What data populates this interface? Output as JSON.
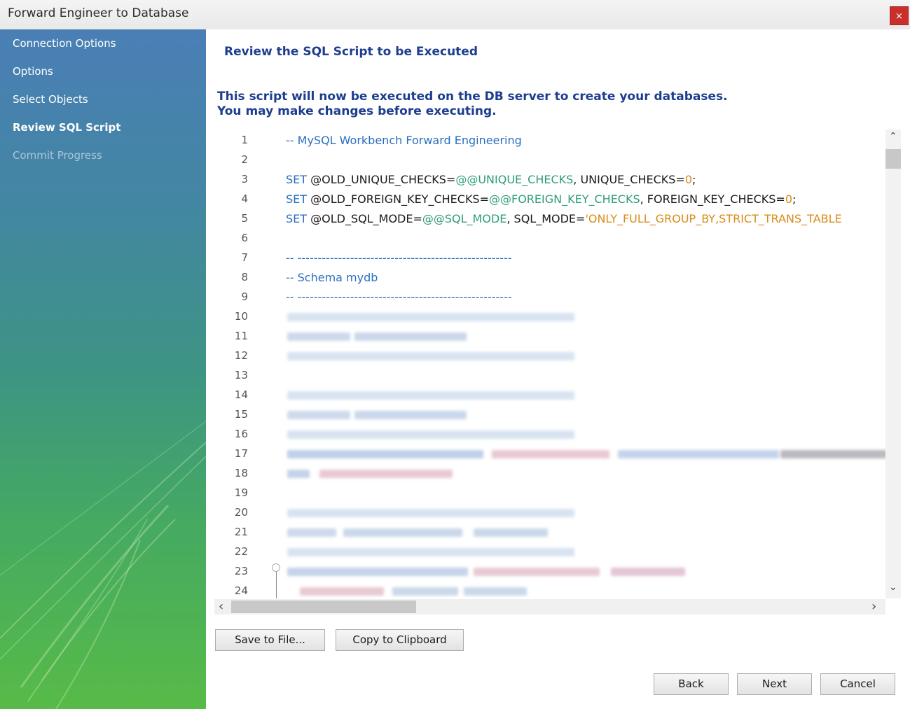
{
  "window": {
    "title": "Forward Engineer to Database",
    "close_glyph": "×"
  },
  "sidebar": {
    "items": [
      {
        "label": "Connection Options",
        "state": "normal"
      },
      {
        "label": "Options",
        "state": "normal"
      },
      {
        "label": "Select Objects",
        "state": "normal"
      },
      {
        "label": "Review SQL Script",
        "state": "active"
      },
      {
        "label": "Commit Progress",
        "state": "disabled"
      }
    ]
  },
  "main": {
    "heading": "Review the SQL Script to be Executed",
    "intro_line1": "This script will now be executed on the DB server to create your databases.",
    "intro_line2": "You may make changes before executing."
  },
  "editor": {
    "lines": [
      {
        "n": "1",
        "comment": "-- MySQL Workbench Forward Engineering"
      },
      {
        "n": "2"
      },
      {
        "n": "3",
        "kw": "SET",
        "a": "@OLD_UNIQUE_CHECKS=",
        "var": "@@UNIQUE_CHECKS",
        "b": ", UNIQUE_CHECKS=",
        "num": "0",
        "end": ";"
      },
      {
        "n": "4",
        "kw": "SET",
        "a": "@OLD_FOREIGN_KEY_CHECKS=",
        "var": "@@FOREIGN_KEY_CHECKS",
        "b": ", FOREIGN_KEY_CHECKS=",
        "num": "0",
        "end": ";"
      },
      {
        "n": "5",
        "kw": "SET",
        "a": "@OLD_SQL_MODE=",
        "var": "@@SQL_MODE",
        "b": ", SQL_MODE=",
        "str": "'ONLY_FULL_GROUP_BY,STRICT_TRANS_TABLE"
      },
      {
        "n": "6"
      },
      {
        "n": "7",
        "comment": "-- -----------------------------------------------------"
      },
      {
        "n": "8",
        "comment": "-- Schema mydb"
      },
      {
        "n": "9",
        "comment": "-- -----------------------------------------------------"
      },
      {
        "n": "10"
      },
      {
        "n": "11"
      },
      {
        "n": "12"
      },
      {
        "n": "13"
      },
      {
        "n": "14"
      },
      {
        "n": "15"
      },
      {
        "n": "16"
      },
      {
        "n": "17"
      },
      {
        "n": "18"
      },
      {
        "n": "19"
      },
      {
        "n": "20"
      },
      {
        "n": "21"
      },
      {
        "n": "22"
      },
      {
        "n": "23"
      },
      {
        "n": "24"
      }
    ]
  },
  "scroll": {
    "up": "⌃",
    "down": "⌄",
    "left": "‹",
    "right": "›"
  },
  "buttons": {
    "save": "Save to File...",
    "copy": "Copy to Clipboard",
    "back": "Back",
    "next": "Next",
    "cancel": "Cancel"
  }
}
